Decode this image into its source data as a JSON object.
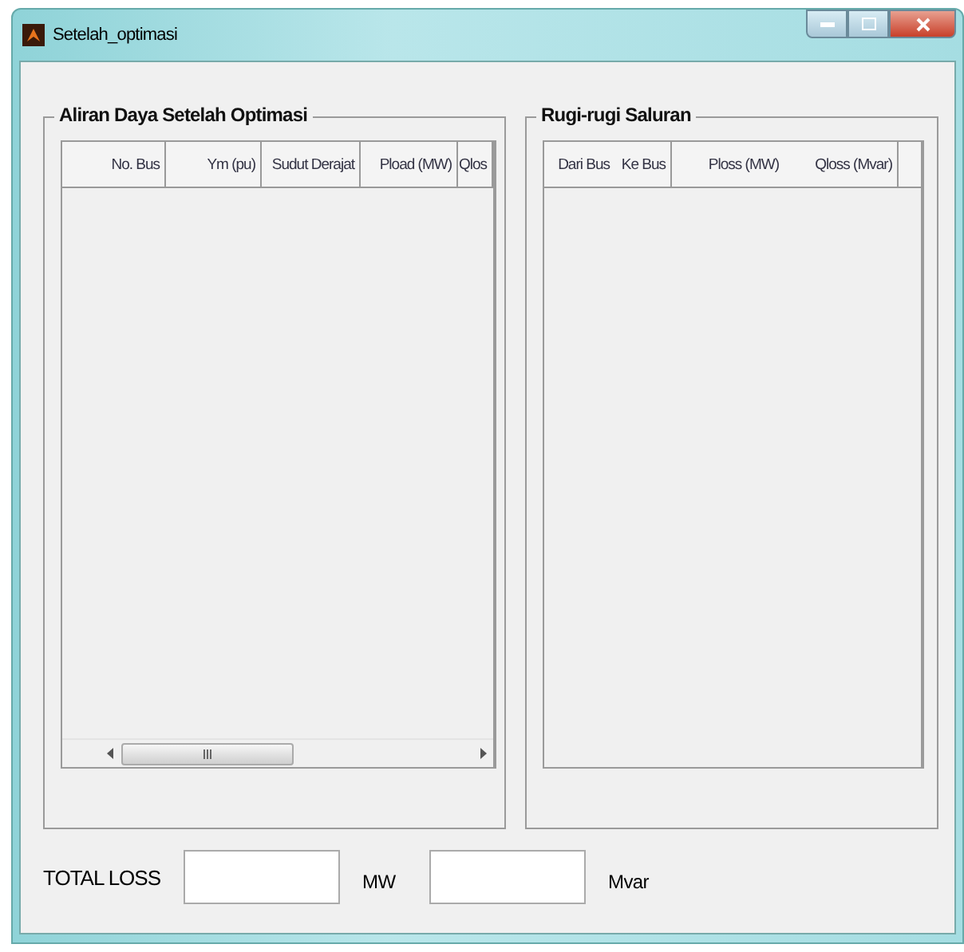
{
  "window": {
    "title": "Setelah_optimasi"
  },
  "panels": [
    {
      "title": "Aliran Daya Setelah Optimasi",
      "columns": [
        "No. Bus",
        "Ym (pu)",
        "Sudut Derajat",
        "Pload (MW)",
        "Qlos"
      ],
      "scrollbar": true
    },
    {
      "title": "Rugi-rugi Saluran",
      "columns": [
        "Dari Bus",
        "Ke Bus",
        "Ploss (MW)",
        "Qloss (Mvar)"
      ],
      "scrollbar": false
    }
  ],
  "footer": {
    "label": "TOTAL LOSS",
    "fields": [
      {
        "unit": "MW"
      },
      {
        "unit": "Mvar"
      }
    ]
  }
}
